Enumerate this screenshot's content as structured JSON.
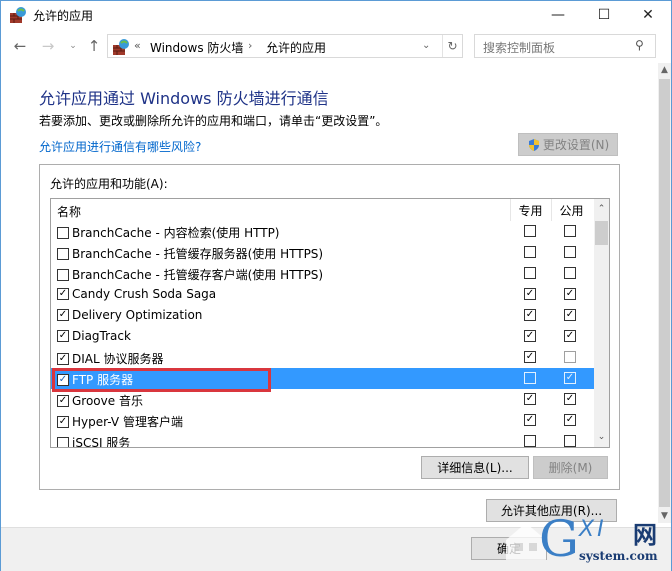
{
  "window": {
    "title": "允许的应用",
    "icon": "firewall-icon",
    "controls": {
      "minimize": "—",
      "maximize": "☐",
      "close": "✕"
    }
  },
  "nav": {
    "back": "←",
    "forward": "→",
    "recent": "⌄",
    "up": "↑",
    "address": {
      "prefix": "«",
      "breadcrumbs": [
        "Windows 防火墙",
        "允许的应用"
      ],
      "separator": "›",
      "dropdown": "⌄",
      "refresh": "↻"
    },
    "search": {
      "placeholder": "搜索控制面板",
      "icon": "⚲"
    }
  },
  "content": {
    "heading": "允许应用通过 Windows 防火墙进行通信",
    "description": "若要添加、更改或删除所允许的应用和端口，请单击“更改设置”。",
    "risk_link": "允许应用进行通信有哪些风险?",
    "change_settings_button": "更改设置(N)",
    "group_label": "允许的应用和功能(A):",
    "columns": {
      "name": "名称",
      "private": "专用",
      "public": "公用"
    },
    "apps": [
      {
        "name": "BranchCache - 内容检索(使用 HTTP)",
        "enabled": false,
        "private": false,
        "public": false,
        "selected": false
      },
      {
        "name": "BranchCache - 托管缓存服务器(使用 HTTPS)",
        "enabled": false,
        "private": false,
        "public": false,
        "selected": false
      },
      {
        "name": "BranchCache - 托管缓存客户端(使用 HTTPS)",
        "enabled": false,
        "private": false,
        "public": false,
        "selected": false
      },
      {
        "name": "Candy Crush Soda Saga",
        "enabled": true,
        "private": true,
        "public": true,
        "selected": false
      },
      {
        "name": "Delivery Optimization",
        "enabled": true,
        "private": true,
        "public": true,
        "selected": false
      },
      {
        "name": "DiagTrack",
        "enabled": true,
        "private": true,
        "public": true,
        "selected": false
      },
      {
        "name": "DIAL 协议服务器",
        "enabled": true,
        "private": true,
        "public": false,
        "selected": false
      },
      {
        "name": "FTP 服务器",
        "enabled": true,
        "private": false,
        "public": true,
        "selected": true
      },
      {
        "name": "Groove 音乐",
        "enabled": true,
        "private": true,
        "public": true,
        "selected": false
      },
      {
        "name": "Hyper-V 管理客户端",
        "enabled": true,
        "private": true,
        "public": true,
        "selected": false
      },
      {
        "name": "iSCSI 服务",
        "enabled": false,
        "private": false,
        "public": false,
        "selected": false
      }
    ],
    "details_button": "详细信息(L)...",
    "remove_button": "删除(M)",
    "allow_other_button": "允许其他应用(R)...",
    "ok_button": "确定"
  },
  "watermark": {
    "letter": "G",
    "xi": "XI",
    "net": "网",
    "domain": "system.com"
  },
  "colors": {
    "heading": "#1e3287",
    "link": "#0066cc",
    "selection": "#3399ff",
    "annotation_box": "#d9363e",
    "window_border": "#5b9bd5"
  }
}
